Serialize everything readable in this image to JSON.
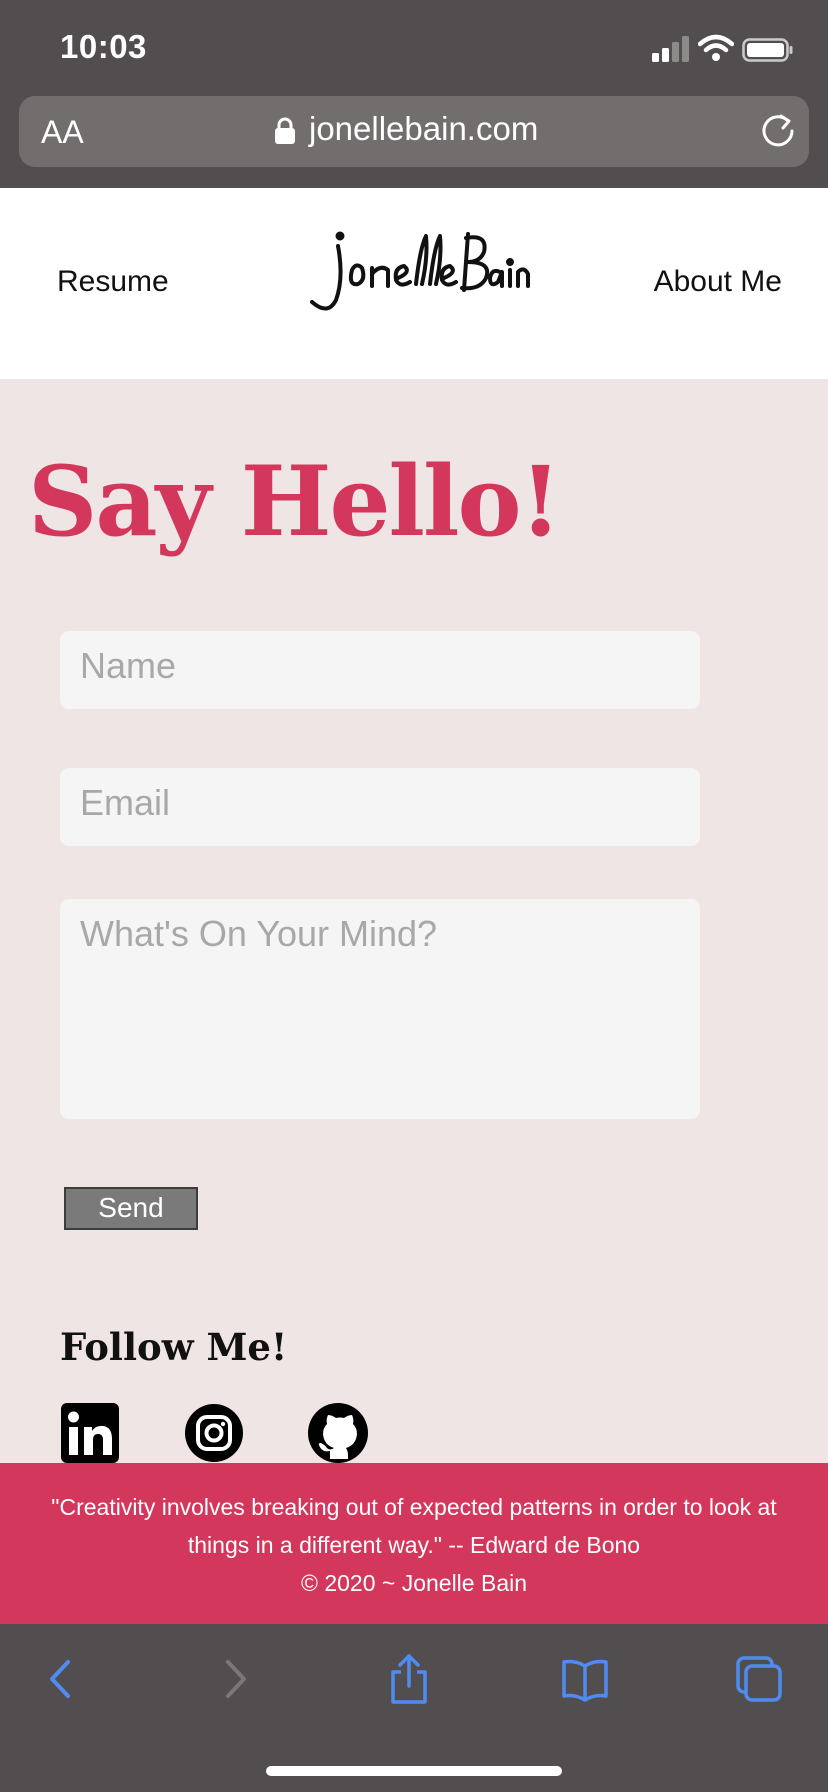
{
  "status_bar": {
    "time": "10:03"
  },
  "browser": {
    "text_size_label": "AA",
    "url": "jonellebain.com"
  },
  "nav": {
    "left_link": "Resume",
    "right_link": "About Me",
    "logo_text": "JonelleBain"
  },
  "main": {
    "heading": "Say Hello!",
    "form": {
      "name_placeholder": "Name",
      "email_placeholder": "Email",
      "message_placeholder": "What's On Your Mind?",
      "send_label": "Send"
    },
    "follow_heading": "Follow Me!",
    "social_icons": [
      "linkedin-icon",
      "instagram-icon",
      "github-icon"
    ]
  },
  "footer": {
    "quote": "\"Creativity involves breaking out of expected patterns in order to look at things in a different way.\" -- Edward de Bono",
    "copyright": "© 2020 ~ Jonelle Bain"
  },
  "colors": {
    "accent": "#d3375c",
    "section_bg": "#efe5e5",
    "browser_chrome": "#524e4f",
    "toolbar_icon": "#4f8bf0"
  }
}
